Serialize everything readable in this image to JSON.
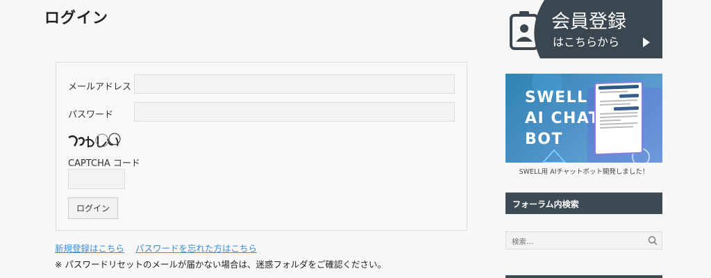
{
  "page": {
    "title": "ログイン"
  },
  "form": {
    "email_label": "メールアドレス",
    "password_label": "パスワード",
    "captcha_label": "CAPTCHA コード",
    "login_button": "ログイン"
  },
  "links": {
    "register": "新規登録はこちら",
    "forgot_password": "パスワードを忘れた方はこちら"
  },
  "note": "※ パスワードリセットのメールが届かない場合は、迷惑フォルダをご確認ください。",
  "sidebar": {
    "signup_banner": {
      "title": "会員登録",
      "sub": "はこちらから"
    },
    "ai_banner": {
      "line1": "SWELL",
      "line2": "AI CHAT",
      "line3": "BOT",
      "caption": "SWELL用 AIチャットボット開発しました！"
    },
    "forum_search": {
      "heading": "フォーラム内検索",
      "placeholder": "検索…"
    }
  },
  "colors": {
    "accent": "#3d4b55",
    "link": "#3a8fd8"
  }
}
